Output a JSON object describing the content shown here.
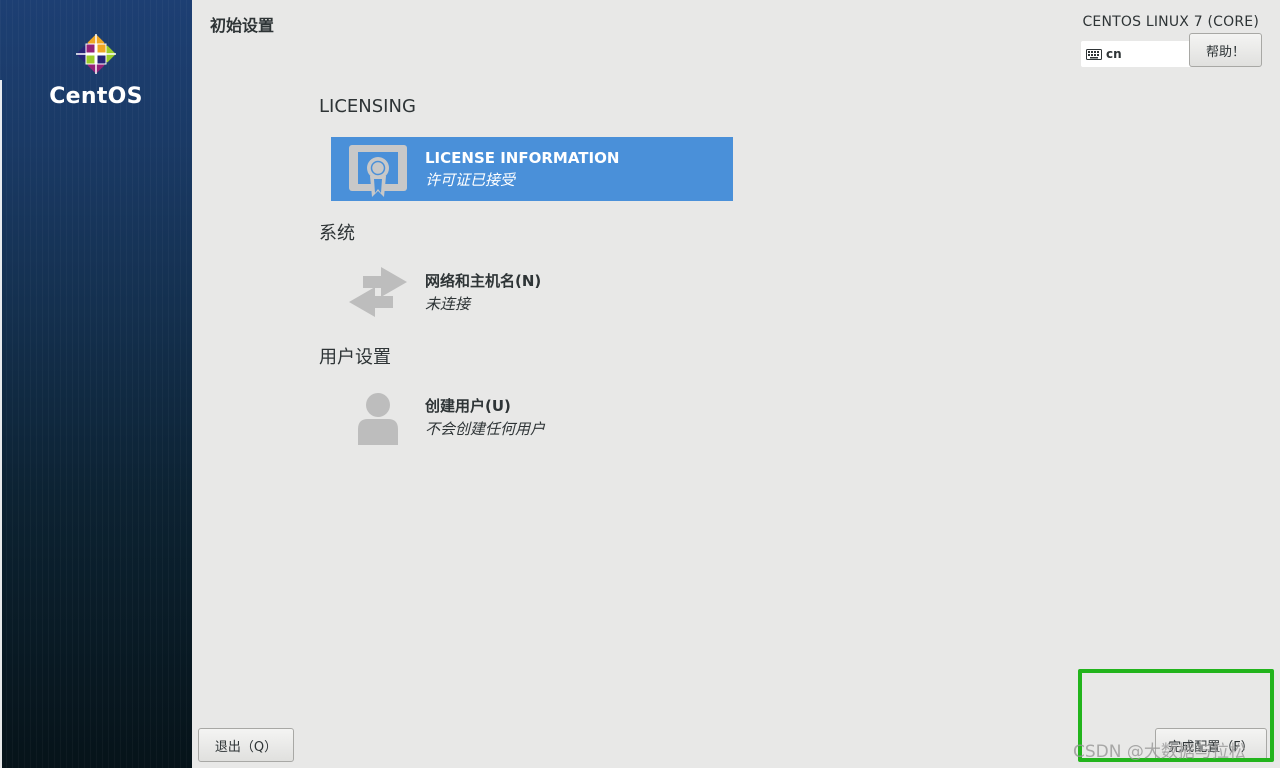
{
  "sidebar": {
    "brand": "CentOS"
  },
  "header": {
    "title": "初始设置",
    "product": "CENTOS LINUX 7 (CORE)",
    "keyboard_layout": "cn",
    "help_label": "帮助！"
  },
  "sections": {
    "licensing": {
      "header": "LICENSING",
      "spoke": {
        "title": "LICENSE INFORMATION",
        "status": "许可证已接受",
        "icon": "license-certificate-icon"
      }
    },
    "system": {
      "header": "系统",
      "spoke": {
        "title": "网络和主机名(N)",
        "status": "未连接",
        "icon": "network-arrows-icon"
      }
    },
    "user_settings": {
      "header": "用户设置",
      "spoke": {
        "title": "创建用户(U)",
        "status": "不会创建任何用户",
        "icon": "user-icon"
      }
    }
  },
  "footer": {
    "quit_label": "退出（Q）",
    "finish_label": "完成配置（F）",
    "watermark": "CSDN @大数据与拉松"
  },
  "colors": {
    "selected_spoke": "#4a90d9",
    "highlight_box": "#22b41c",
    "background": "#e8e8e7"
  }
}
